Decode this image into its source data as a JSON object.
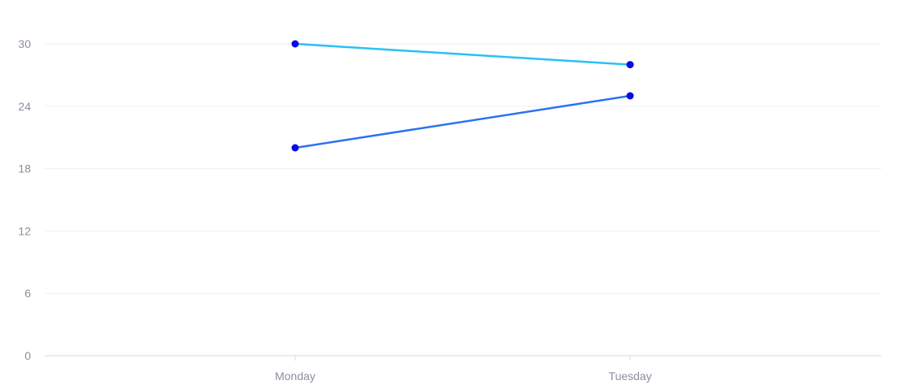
{
  "chart_data": {
    "type": "line",
    "categories": [
      "Monday",
      "Tuesday"
    ],
    "series": [
      {
        "values": [
          30,
          28
        ],
        "color": "#29c1f5"
      },
      {
        "values": [
          20,
          25
        ],
        "color": "#2b72f0"
      }
    ],
    "point_color": "#0a0ae6",
    "ylim": [
      0,
      30
    ],
    "yticks": [
      0,
      6,
      12,
      18,
      24,
      30
    ],
    "grid": true,
    "legend": "none"
  }
}
